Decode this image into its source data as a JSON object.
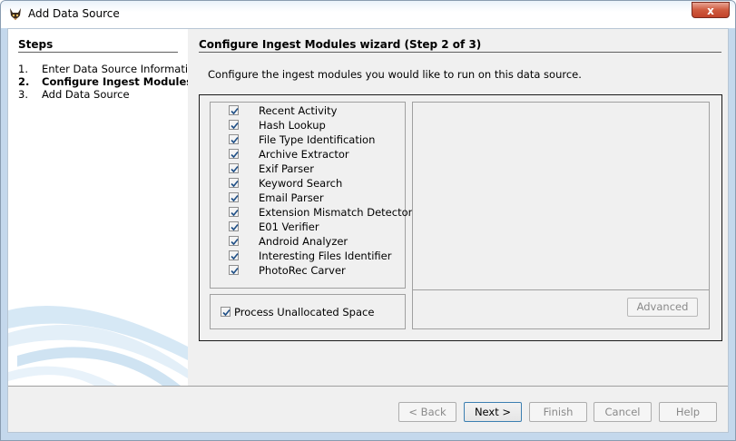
{
  "window": {
    "title": "Add Data Source",
    "close_label": "x"
  },
  "steps": {
    "title": "Steps",
    "items": [
      {
        "num": "1.",
        "label": "Enter Data Source Information"
      },
      {
        "num": "2.",
        "label": "Configure Ingest Modules",
        "active": true
      },
      {
        "num": "3.",
        "label": "Add Data Source"
      }
    ]
  },
  "wizard": {
    "title": "Configure Ingest Modules wizard (Step 2 of 3)",
    "description": "Configure the ingest modules you would like to run on this data source."
  },
  "modules": [
    {
      "label": "Recent Activity",
      "checked": true
    },
    {
      "label": "Hash Lookup",
      "checked": true
    },
    {
      "label": "File Type Identification",
      "checked": true
    },
    {
      "label": "Archive Extractor",
      "checked": true
    },
    {
      "label": "Exif Parser",
      "checked": true
    },
    {
      "label": "Keyword Search",
      "checked": true
    },
    {
      "label": "Email Parser",
      "checked": true
    },
    {
      "label": "Extension Mismatch Detector",
      "checked": true
    },
    {
      "label": "E01 Verifier",
      "checked": true
    },
    {
      "label": "Android Analyzer",
      "checked": true
    },
    {
      "label": "Interesting Files Identifier",
      "checked": true
    },
    {
      "label": "PhotoRec Carver",
      "checked": true
    }
  ],
  "unallocated": {
    "label": "Process Unallocated Space",
    "checked": true
  },
  "settings": {
    "advanced_label": "Advanced"
  },
  "buttons": {
    "back": "< Back",
    "next": "Next >",
    "finish": "Finish",
    "cancel": "Cancel",
    "help": "Help"
  },
  "colors": {
    "accent": "#3c7fb1",
    "check": "#1f4f86"
  }
}
